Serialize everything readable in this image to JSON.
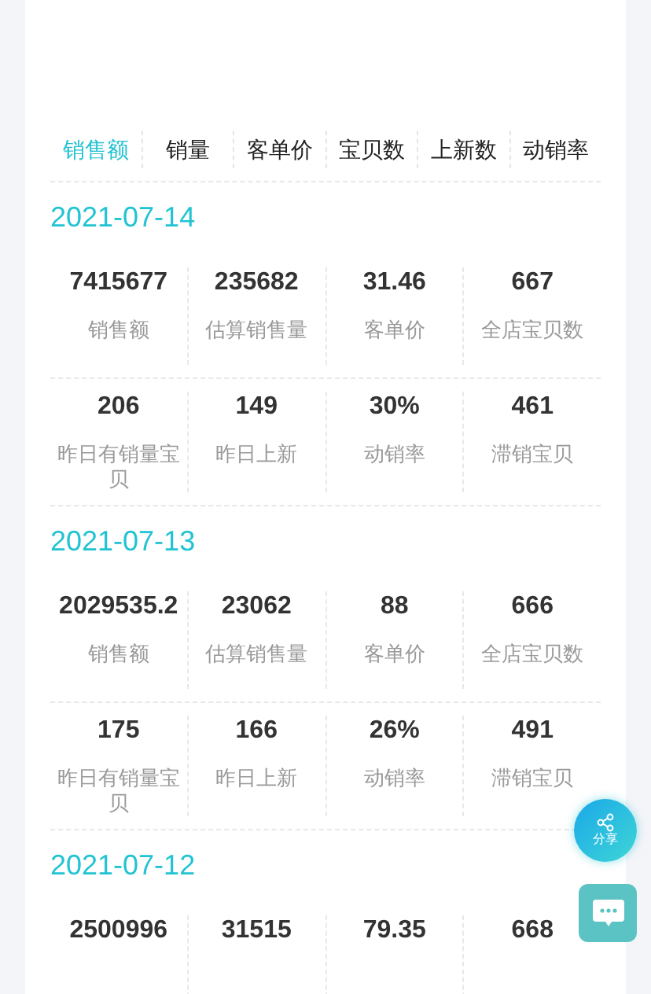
{
  "tabs": [
    {
      "label": "销售额",
      "selected": true
    },
    {
      "label": "销量",
      "selected": false
    },
    {
      "label": "客单价",
      "selected": false
    },
    {
      "label": "宝贝数",
      "selected": false
    },
    {
      "label": "上新数",
      "selected": false
    },
    {
      "label": "动销率",
      "selected": false
    }
  ],
  "days": [
    {
      "date": "2021-07-14",
      "rows": [
        [
          {
            "value": "7415677",
            "label": "销售额"
          },
          {
            "value": "235682",
            "label": "估算销售量"
          },
          {
            "value": "31.46",
            "label": "客单价"
          },
          {
            "value": "667",
            "label": "全店宝贝数"
          }
        ],
        [
          {
            "value": "206",
            "label": "昨日有销量宝贝"
          },
          {
            "value": "149",
            "label": "昨日上新"
          },
          {
            "value": "30%",
            "label": "动销率"
          },
          {
            "value": "461",
            "label": "滞销宝贝"
          }
        ]
      ]
    },
    {
      "date": "2021-07-13",
      "rows": [
        [
          {
            "value": "2029535.2",
            "label": "销售额"
          },
          {
            "value": "23062",
            "label": "估算销售量"
          },
          {
            "value": "88",
            "label": "客单价"
          },
          {
            "value": "666",
            "label": "全店宝贝数"
          }
        ],
        [
          {
            "value": "175",
            "label": "昨日有销量宝贝"
          },
          {
            "value": "166",
            "label": "昨日上新"
          },
          {
            "value": "26%",
            "label": "动销率"
          },
          {
            "value": "491",
            "label": "滞销宝贝"
          }
        ]
      ]
    },
    {
      "date": "2021-07-12",
      "rows": [
        [
          {
            "value": "2500996"
          },
          {
            "value": "31515"
          },
          {
            "value": "79.35"
          },
          {
            "value": "668"
          }
        ]
      ]
    }
  ],
  "share_button": {
    "label": "分享"
  }
}
